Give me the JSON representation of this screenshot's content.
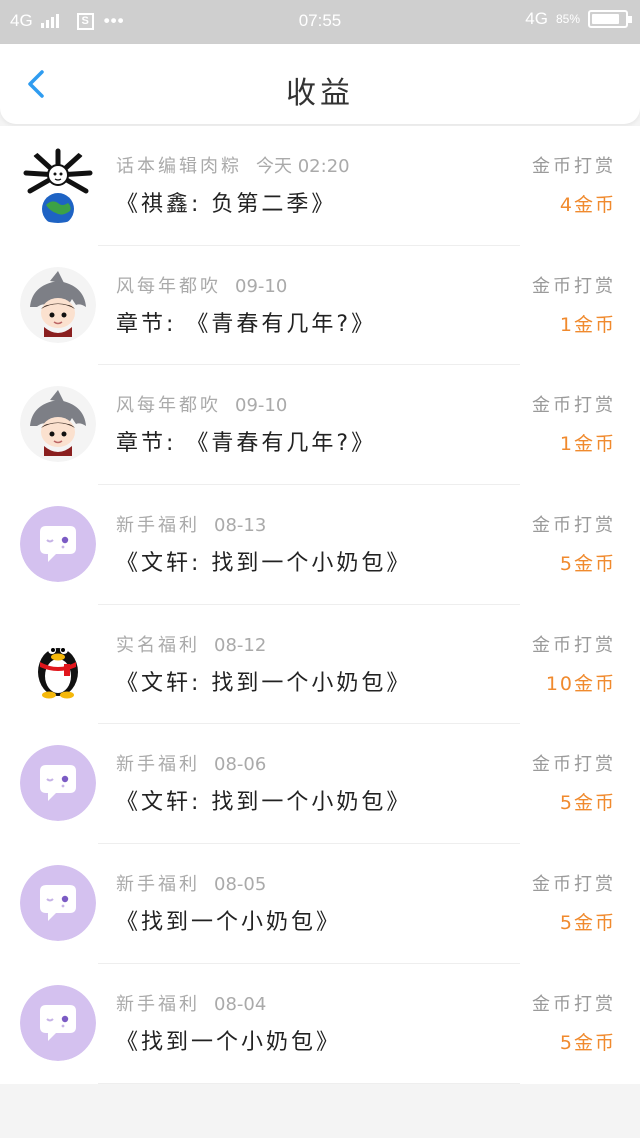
{
  "status_bar": {
    "network": "4G",
    "sim_icon": "sim-s-icon",
    "more": "•••",
    "time": "07:55",
    "network_right": "4G",
    "battery_percent": "85%",
    "battery_level": 0.85
  },
  "nav": {
    "back_icon": "chevron-left-icon",
    "title": "收益",
    "accent_color": "#2f9cf0"
  },
  "items": [
    {
      "avatar": "comic-hair-earth-avatar",
      "name": "话本编辑肉粽",
      "date": "今天 02:20",
      "title": "《祺鑫: 负第二季》",
      "type": "金币打赏",
      "amount": "4金币"
    },
    {
      "avatar": "shark-hood-boy-avatar",
      "name": "风每年都吹",
      "date": "09-10",
      "title": "章节: 《青春有几年?》",
      "type": "金币打赏",
      "amount": "1金币"
    },
    {
      "avatar": "shark-hood-boy-avatar",
      "name": "风每年都吹",
      "date": "09-10",
      "title": "章节: 《青春有几年?》",
      "type": "金币打赏",
      "amount": "1金币"
    },
    {
      "avatar": "purple-chat-bubble-avatar",
      "name": "新手福利",
      "date": "08-13",
      "title": "《文轩: 找到一个小奶包》",
      "type": "金币打赏",
      "amount": "5金币"
    },
    {
      "avatar": "qq-penguin-avatar",
      "name": "实名福利",
      "date": "08-12",
      "title": "《文轩: 找到一个小奶包》",
      "type": "金币打赏",
      "amount": "10金币"
    },
    {
      "avatar": "purple-chat-bubble-avatar",
      "name": "新手福利",
      "date": "08-06",
      "title": "《文轩: 找到一个小奶包》",
      "type": "金币打赏",
      "amount": "5金币"
    },
    {
      "avatar": "purple-chat-bubble-avatar",
      "name": "新手福利",
      "date": "08-05",
      "title": "《找到一个小奶包》",
      "type": "金币打赏",
      "amount": "5金币"
    },
    {
      "avatar": "purple-chat-bubble-avatar",
      "name": "新手福利",
      "date": "08-04",
      "title": "《找到一个小奶包》",
      "type": "金币打赏",
      "amount": "5金币"
    }
  ]
}
